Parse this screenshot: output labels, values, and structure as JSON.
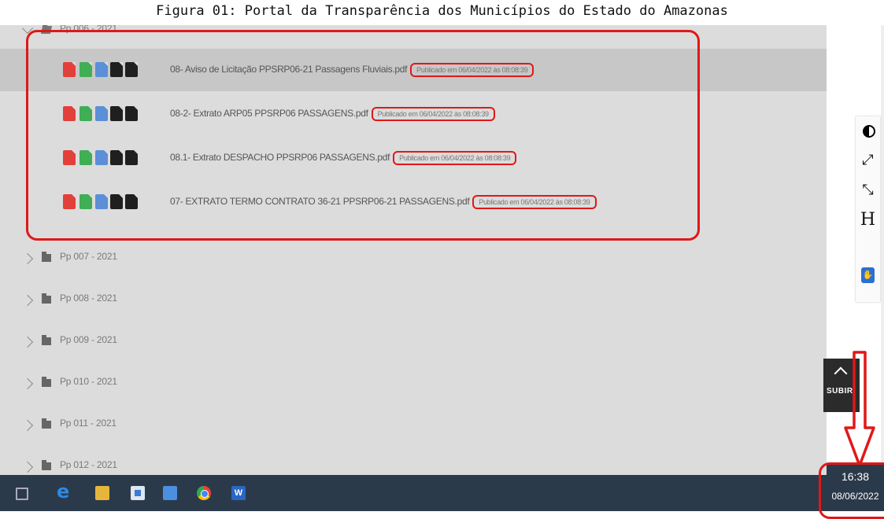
{
  "caption": "Figura 01: Portal da Transparência dos Municípios do Estado do Amazonas",
  "tree": {
    "open_folder": "Pp 006 - 2021",
    "files": [
      {
        "name": "08- Aviso de Licitação PPSRP06-21 Passagens Fluviais.pdf",
        "published": "Publicado em 06/04/2022 às 08:08:39"
      },
      {
        "name": "08-2- Extrato ARP05 PPSRP06 PASSAGENS.pdf",
        "published": "Publicado em 06/04/2022 às 08:08:39"
      },
      {
        "name": "08.1- Extrato DESPACHO PPSRP06 PASSAGENS.pdf",
        "published": "Publicado em 06/04/2022 às 08:08:39"
      },
      {
        "name": "07- EXTRATO TERMO CONTRATO 36-21 PPSRP06-21 PASSAGENS.pdf",
        "published": "Publicado em 06/04/2022 às 08:08:39"
      }
    ],
    "folders": [
      "Pp 007 - 2021",
      "Pp 008 - 2021",
      "Pp 009 - 2021",
      "Pp 010 - 2021",
      "Pp 011 - 2021",
      "Pp 012 - 2021"
    ]
  },
  "accessibility": {
    "heading_button": "H"
  },
  "scroll_top": {
    "label": "SUBIR"
  },
  "taskbar": {
    "time": "16:38",
    "date": "08/06/2022"
  },
  "colors": {
    "highlight_red": "#e01818",
    "tree_bg": "#dcdcdc",
    "selected_row_bg": "#c7c7c7",
    "taskbar_bg": "#2b3a4a"
  },
  "icons": [
    "folder-open-icon",
    "folder-icon",
    "pdf-icon",
    "xls-icon",
    "doc-icon",
    "xml-icon",
    "txt-icon",
    "contrast-icon",
    "expand-icon",
    "shrink-icon",
    "vlibras-icon",
    "windows-start-icon",
    "edge-icon",
    "file-explorer-icon",
    "store-icon",
    "mail-icon",
    "chrome-icon",
    "word-icon"
  ]
}
